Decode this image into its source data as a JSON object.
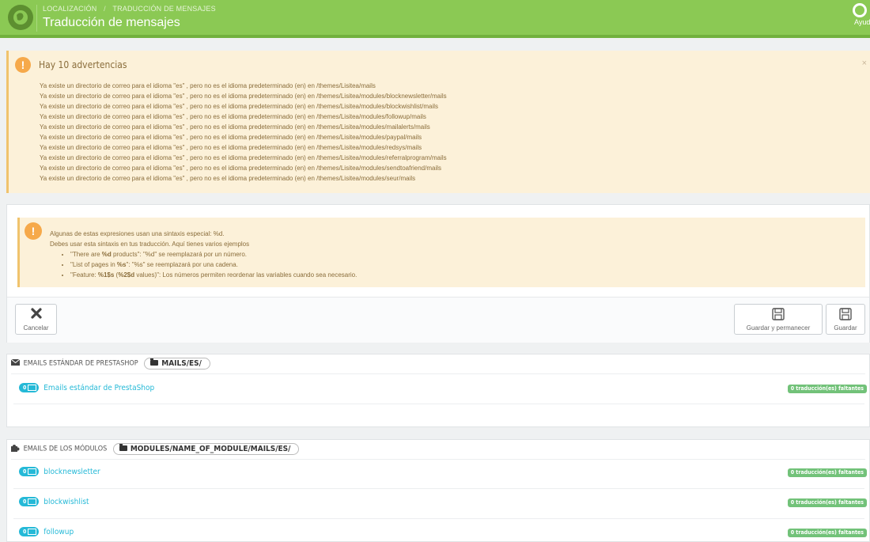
{
  "header": {
    "breadcrumb": [
      "Localización",
      "Traducción de mensajes"
    ],
    "title": "Traducción de mensajes",
    "help_label": "Ayuda"
  },
  "warnings": {
    "title": "Hay 10 advertencias",
    "close": "×",
    "items": [
      "Ya existe un directorio de correo para el idioma \"es\" , pero no es el idioma predeterminado (en) en /themes/Lisitea/mails",
      "Ya existe un directorio de correo para el idioma \"es\" , pero no es el idioma predeterminado (en) en /themes/Lisitea/modules/blocknewsletter/mails",
      "Ya existe un directorio de correo para el idioma \"es\" , pero no es el idioma predeterminado (en) en /themes/Lisitea/modules/blockwishlist/mails",
      "Ya existe un directorio de correo para el idioma \"es\" , pero no es el idioma predeterminado (en) en /themes/Lisitea/modules/followup/mails",
      "Ya existe un directorio de correo para el idioma \"es\" , pero no es el idioma predeterminado (en) en /themes/Lisitea/modules/mailalerts/mails",
      "Ya existe un directorio de correo para el idioma \"es\" , pero no es el idioma predeterminado (en) en /themes/Lisitea/modules/paypal/mails",
      "Ya existe un directorio de correo para el idioma \"es\" , pero no es el idioma predeterminado (en) en /themes/Lisitea/modules/redsys/mails",
      "Ya existe un directorio de correo para el idioma \"es\" , pero no es el idioma predeterminado (en) en /themes/Lisitea/modules/referralprogram/mails",
      "Ya existe un directorio de correo para el idioma \"es\" , pero no es el idioma predeterminado (en) en /themes/Lisitea/modules/sendtoafriend/mails",
      "Ya existe un directorio de correo para el idioma \"es\" , pero no es el idioma predeterminado (en) en /themes/Lisitea/modules/seur/mails"
    ]
  },
  "syntax_info": {
    "line1": "Algunas de estas expresiones usan una sintaxis especial: %d.",
    "line2": "Debes usar esta sintaxis en tus traducción. Aquí tienes varios ejemplos",
    "ex1_a": "\"There are ",
    "ex1_b": "%d",
    "ex1_c": " products\": \"%d\" se reemplazará por un número.",
    "ex2_a": "\"List of pages in ",
    "ex2_b": "%s",
    "ex2_c": "\": \"%s\" se reemplazará por una cadena.",
    "ex3_a": "\"Feature: ",
    "ex3_b": "%1$s",
    "ex3_c": " (",
    "ex3_d": "%2$d",
    "ex3_e": " values)\": Los números permiten reordenar las variables cuando sea necesario."
  },
  "toolbar": {
    "cancel": "Cancelar",
    "save_stay": "Guardar y permanecer",
    "save": "Guardar"
  },
  "standard_emails": {
    "heading": "Emails estándar de PrestaShop",
    "path": "MAILS/ES/",
    "rows": [
      {
        "count": "0",
        "name": "Emails estándar de PrestaShop",
        "missing": "0 traducción(es) faltantes"
      }
    ]
  },
  "module_emails": {
    "heading": "Emails de los módulos",
    "path": "MODULES/NAME_OF_MODULE/MAILS/ES/",
    "rows": [
      {
        "count": "0",
        "name": "blocknewsletter",
        "missing": "0 traducción(es) faltantes"
      },
      {
        "count": "0",
        "name": "blockwishlist",
        "missing": "0 traducción(es) faltantes"
      },
      {
        "count": "0",
        "name": "followup",
        "missing": "0 traducción(es) faltantes"
      }
    ]
  },
  "colors": {
    "header_green": "#8bc954",
    "warning_bg": "#fcf1d9",
    "link_blue": "#25b9d7",
    "badge_green": "#72c279"
  }
}
